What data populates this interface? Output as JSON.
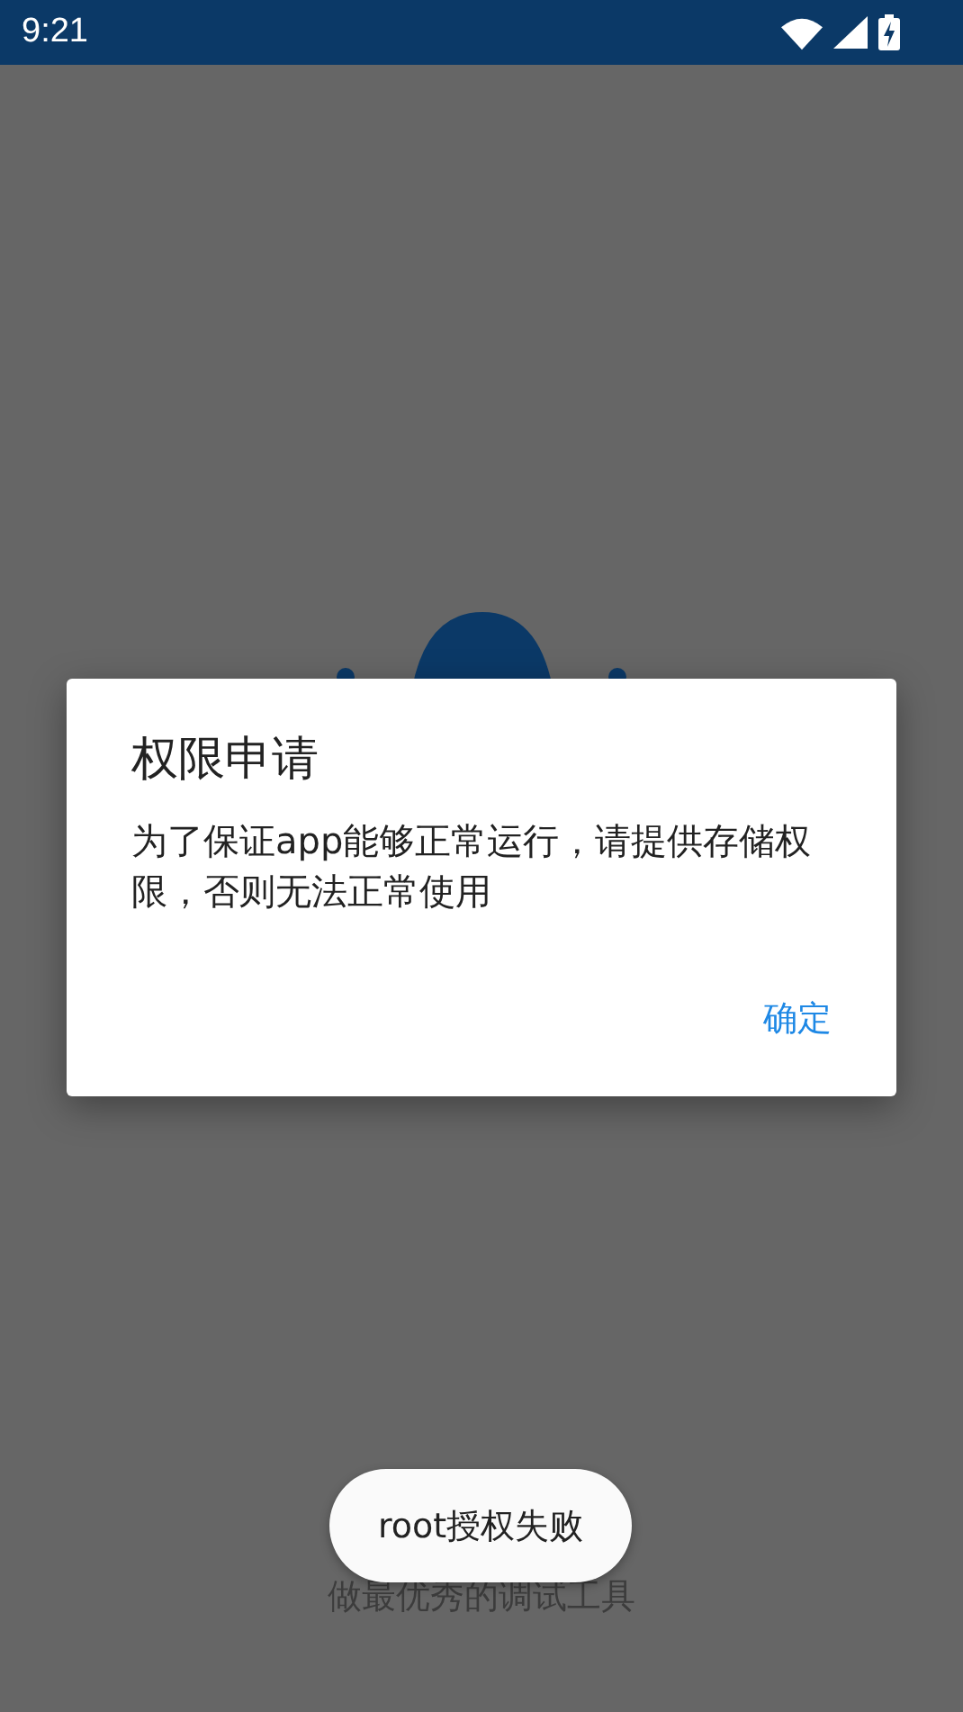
{
  "status_bar": {
    "time": "9:21"
  },
  "app": {
    "tagline": "做最优秀的调试工具"
  },
  "dialog": {
    "title": "权限申请",
    "message": "为了保证app能够正常运行，请提供存储权限，否则无法正常使用",
    "buttons": [
      "确定"
    ]
  },
  "toast": {
    "text": "root授权失败"
  }
}
